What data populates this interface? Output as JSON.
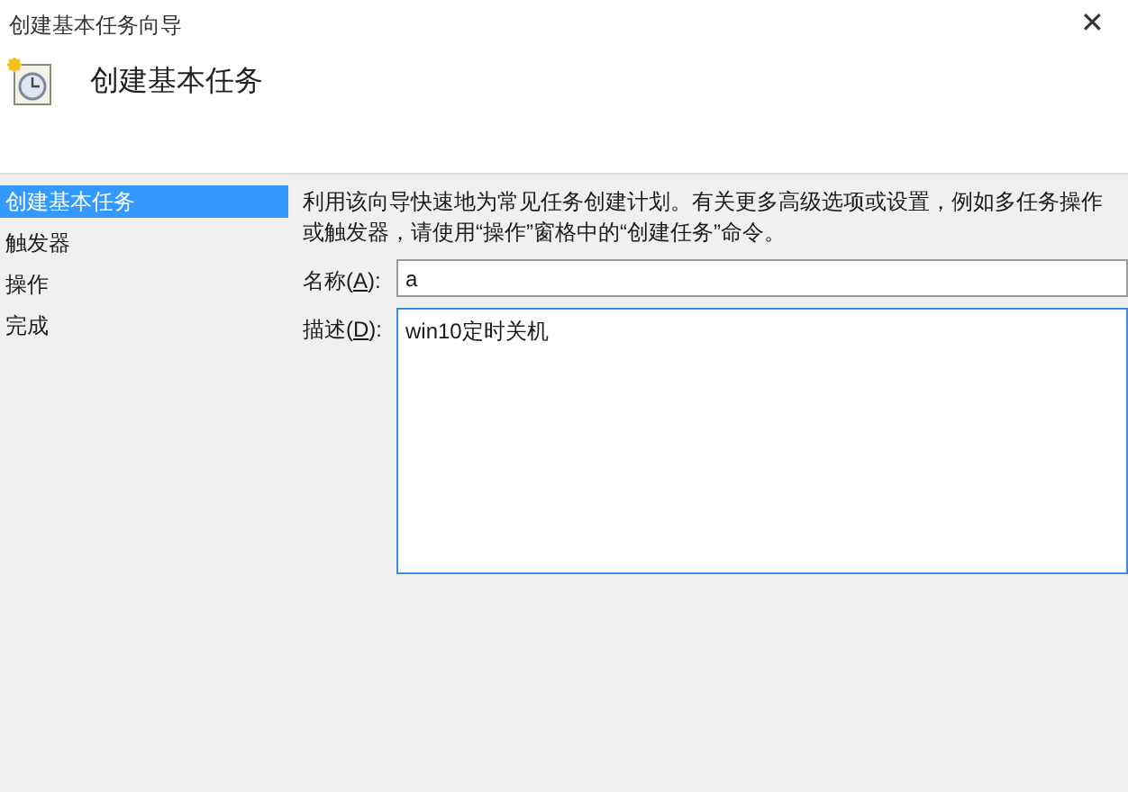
{
  "window": {
    "title": "创建基本任务向导",
    "close": "✕"
  },
  "header": {
    "title": "创建基本任务"
  },
  "sidebar": {
    "items": [
      {
        "label": "创建基本任务",
        "selected": true
      },
      {
        "label": "触发器",
        "selected": false
      },
      {
        "label": "操作",
        "selected": false
      },
      {
        "label": "完成",
        "selected": false
      }
    ]
  },
  "intro": "利用该向导快速地为常见任务创建计划。有关更多高级选项或设置，例如多任务操作或触发器，请使用“操作”窗格中的“创建任务”命令。",
  "fields": [
    {
      "kind": "line",
      "label_before": "名称(",
      "access_key": "A",
      "label_after": "):",
      "value": "a",
      "focused": false
    },
    {
      "kind": "area",
      "label_before": "描述(",
      "access_key": "D",
      "label_after": "):",
      "value": "win10定时关机",
      "focused": true
    }
  ]
}
